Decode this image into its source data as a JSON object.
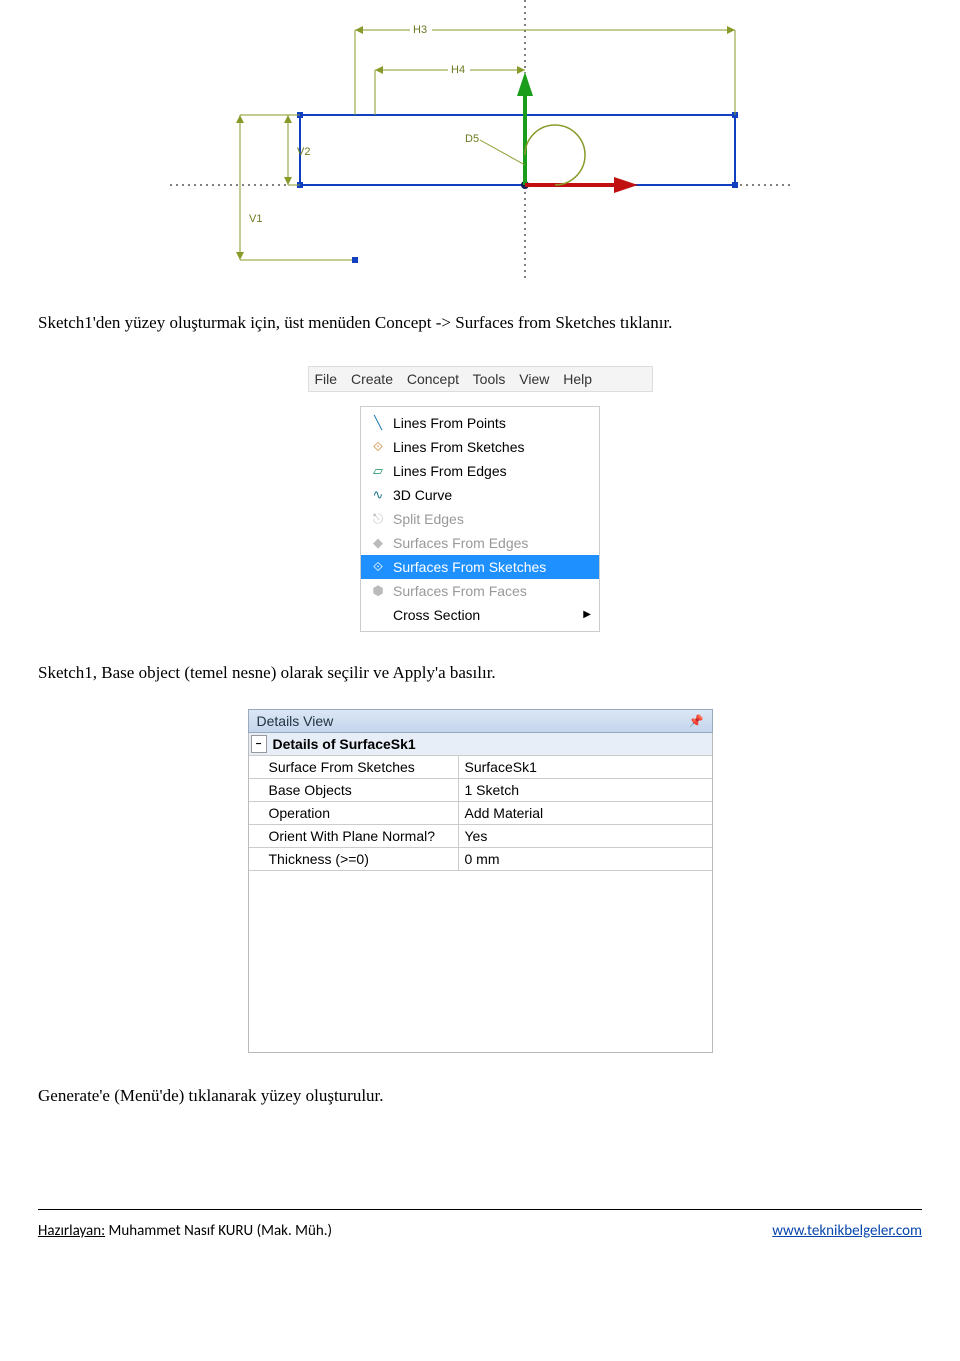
{
  "sketch": {
    "dims": {
      "H3": "H3",
      "H4": "H4",
      "V1": "V1",
      "V2": "V2",
      "D5": "D5"
    }
  },
  "para1": "Sketch1'den yüzey oluşturmak için, üst menüden Concept -> Surfaces from Sketches tıklanır.",
  "menubar": {
    "items": [
      "File",
      "Create",
      "Concept",
      "Tools",
      "View",
      "Help"
    ]
  },
  "dropdown": {
    "items": [
      {
        "label": "Lines From Points",
        "selected": false,
        "disabled": false,
        "iconColor": "#1f77b4"
      },
      {
        "label": "Lines From Sketches",
        "selected": false,
        "disabled": false,
        "iconColor": "#d08a3a"
      },
      {
        "label": "Lines From Edges",
        "selected": false,
        "disabled": false,
        "iconColor": "#1a8f5c"
      },
      {
        "label": "3D Curve",
        "selected": false,
        "disabled": false,
        "iconColor": "#1f7a8c"
      },
      {
        "label": "Split Edges",
        "selected": false,
        "disabled": true,
        "iconColor": "#bbb"
      },
      {
        "label": "Surfaces From Edges",
        "selected": false,
        "disabled": true,
        "iconColor": "#bbb"
      },
      {
        "label": "Surfaces From Sketches",
        "selected": true,
        "disabled": false,
        "iconColor": "#d08a3a"
      },
      {
        "label": "Surfaces From Faces",
        "selected": false,
        "disabled": true,
        "iconColor": "#bbb"
      },
      {
        "label": "Cross Section",
        "selected": false,
        "disabled": false,
        "iconColor": "transparent",
        "arrow": true
      }
    ]
  },
  "para2": "Sketch1, Base object (temel nesne) olarak seçilir ve Apply'a basılır.",
  "details": {
    "header": "Details View",
    "groupTitle": "Details of SurfaceSk1",
    "rows": [
      {
        "k": "Surface From Sketches",
        "v": "SurfaceSk1"
      },
      {
        "k": "Base Objects",
        "v": "1 Sketch"
      },
      {
        "k": "Operation",
        "v": "Add Material"
      },
      {
        "k": "Orient With Plane Normal?",
        "v": "Yes"
      },
      {
        "k": "Thickness (>=0)",
        "v": "0 mm"
      }
    ]
  },
  "para3": "Generate'e (Menü'de) tıklanarak yüzey oluşturulur.",
  "footer": {
    "prepared_label": "Hazırlayan:",
    "author": "Muhammet Nasıf KURU (Mak. Müh.)",
    "url": "www.teknikbelgeler.com"
  }
}
